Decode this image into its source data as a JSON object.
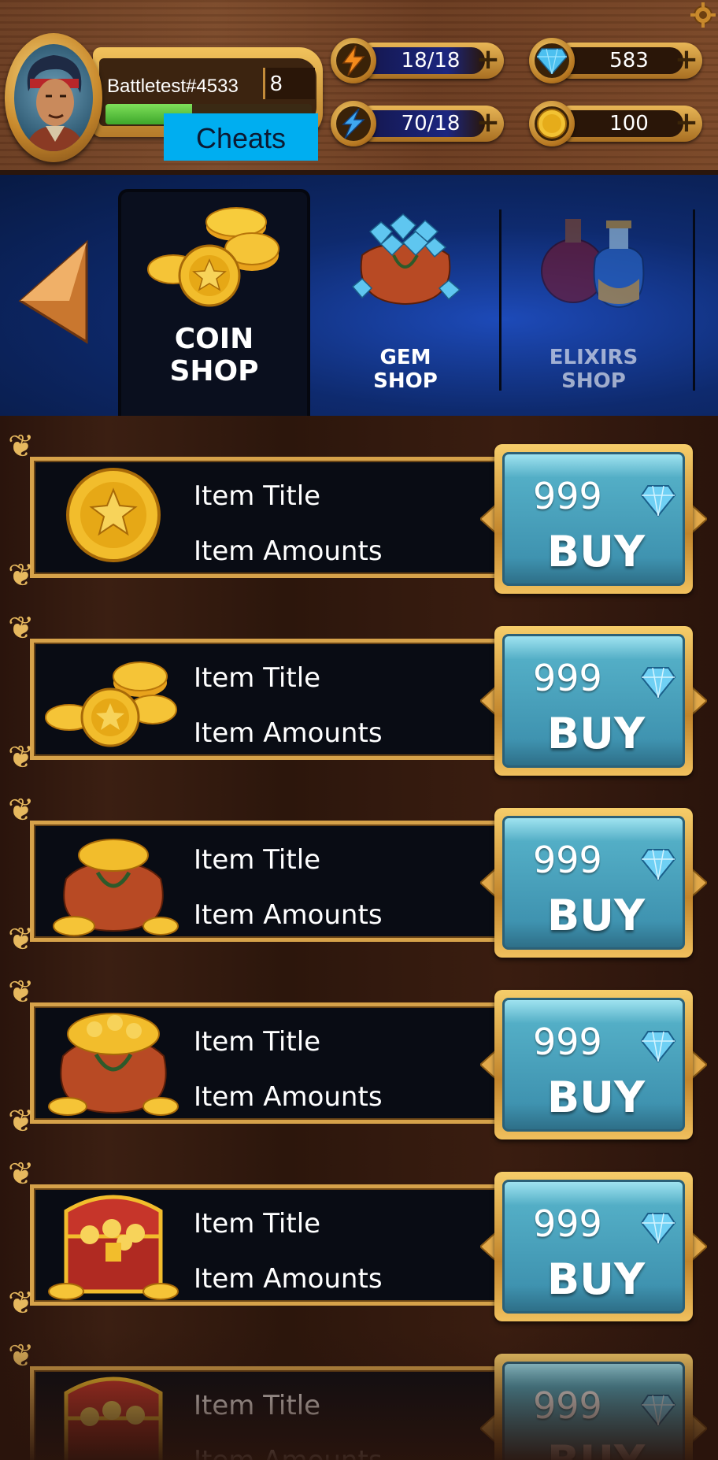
{
  "header": {
    "player_name": "Battletest#4533",
    "level": "8",
    "xp_progress": 0.42,
    "cheats_label": "Cheats",
    "stats": [
      {
        "icon": "energy-icon",
        "value": "18/18"
      },
      {
        "icon": "gem-icon",
        "value": "583"
      },
      {
        "icon": "lightning-icon",
        "value": "70/18"
      },
      {
        "icon": "coin-icon",
        "value": "100"
      }
    ]
  },
  "tabs": [
    {
      "line1": "COIN",
      "line2": "SHOP",
      "active": true
    },
    {
      "line1": "GEM",
      "line2": "SHOP",
      "active": false
    },
    {
      "line1": "ELIXIRS",
      "line2": "SHOP",
      "active": false
    }
  ],
  "items": [
    {
      "icon": "single-coin-icon",
      "title": "Item Title",
      "amount": "Item Amounts",
      "price": "999",
      "buy_label": "BUY"
    },
    {
      "icon": "coin-stack-icon",
      "title": "Item Title",
      "amount": "Item Amounts",
      "price": "999",
      "buy_label": "BUY"
    },
    {
      "icon": "coin-pouch-icon",
      "title": "Item Title",
      "amount": "Item Amounts",
      "price": "999",
      "buy_label": "BUY"
    },
    {
      "icon": "coin-sack-icon",
      "title": "Item Title",
      "amount": "Item Amounts",
      "price": "999",
      "buy_label": "BUY"
    },
    {
      "icon": "treasure-chest-icon",
      "title": "Item Title",
      "amount": "Item Amounts",
      "price": "999",
      "buy_label": "BUY"
    },
    {
      "icon": "big-treasure-chest-icon",
      "title": "Item Title",
      "amount": "Item Amounts",
      "price": "999",
      "buy_label": "BUY"
    }
  ],
  "colors": {
    "gold": "#e6b85e",
    "buy_blue": "#4fa9c4",
    "cheats_blue": "#00aef0",
    "xp_green": "#5cc83e"
  }
}
